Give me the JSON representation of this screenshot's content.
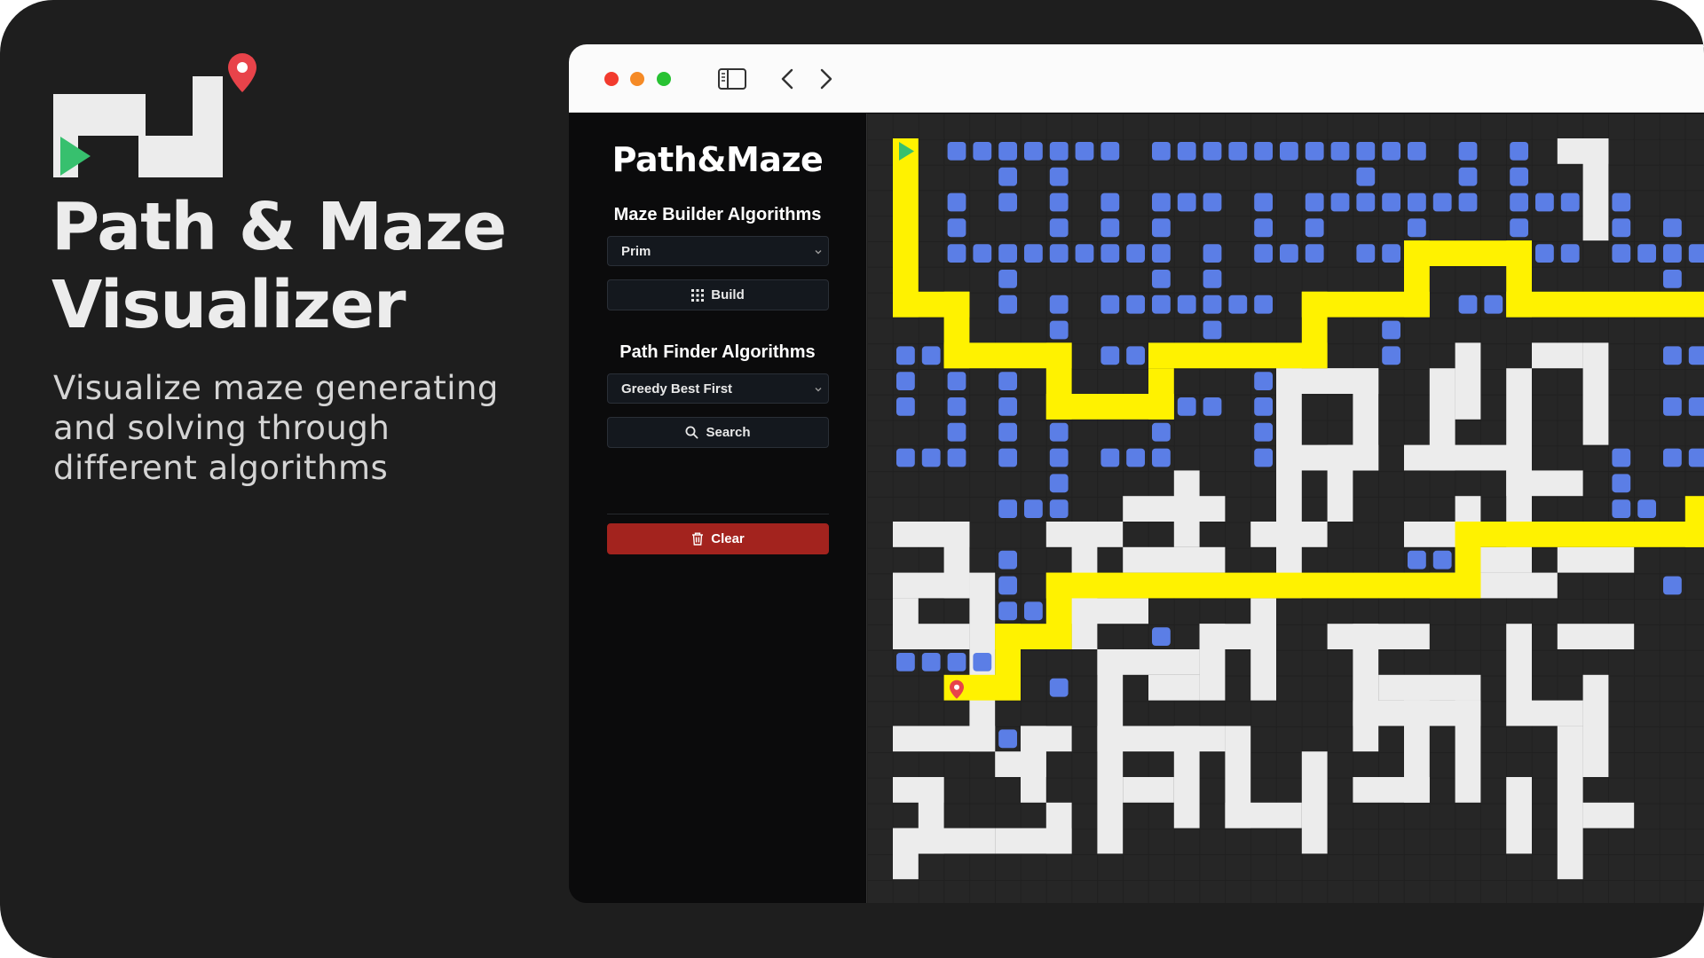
{
  "hero": {
    "title_line1": "Path & Maze",
    "title_line2": "Visualizer",
    "subtitle": "Visualize maze generating and solving through different algorithms"
  },
  "browser": {
    "icons": [
      "close-dot",
      "minimize-dot",
      "maximize-dot",
      "sidebar-toggle-icon",
      "back-icon",
      "forward-icon"
    ]
  },
  "app": {
    "title": "Path&Maze",
    "maze_builder": {
      "heading": "Maze Builder Algorithms",
      "selected": "Prim",
      "build_label": "Build"
    },
    "path_finder": {
      "heading": "Path Finder Algorithms",
      "selected": "Greedy Best First",
      "search_label": "Search"
    },
    "clear_label": "Clear"
  },
  "colors": {
    "background": "#1e1e1e",
    "wall": "#ececec",
    "open_cell": "#262626",
    "visited": "#5b7ee6",
    "path": "#fff200",
    "start": "#37c06e",
    "end": "#e8434a",
    "clear_button": "#a3231e"
  }
}
